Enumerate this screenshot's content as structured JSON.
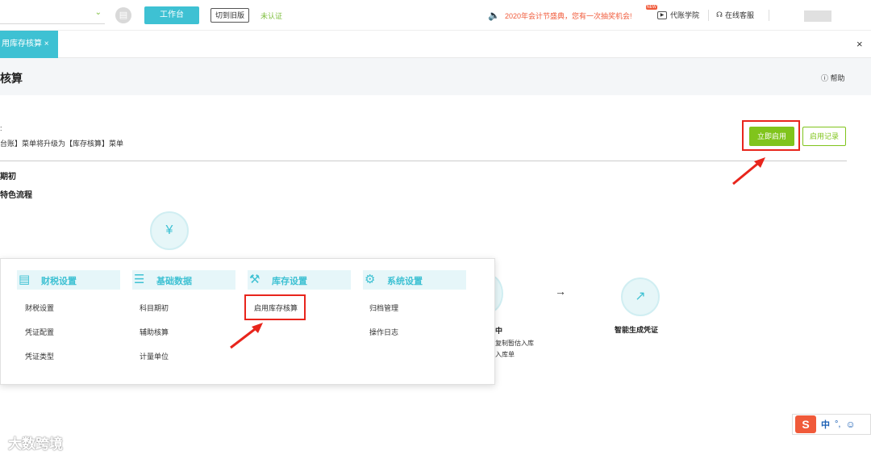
{
  "topbar": {
    "workbench_label": "工作台",
    "old_version_label": "切到旧版",
    "auth_status": "未认证",
    "promo_text": "2020年会计节盛典，您有一次抽奖机会!",
    "academy_badge": "NEW",
    "academy_label": "代账学院",
    "service_label": "在线客服"
  },
  "tabs": {
    "active_label": "用库存核算 ×",
    "close_all": "×"
  },
  "page": {
    "title": "核算",
    "help_label": "帮助"
  },
  "intro": {
    "bullet": ":",
    "text": "台账】菜单将升级为【库存核算】菜单"
  },
  "actions": {
    "enable_label": "立即启用",
    "records_label": "启用记录"
  },
  "sections": {
    "opening": "期初",
    "feature_flow": "特色流程"
  },
  "flow": {
    "arrow": "→",
    "partial_step": "中",
    "partial_desc1": "复制暂估入库",
    "partial_desc2": "入库单",
    "voucher_label": "智能生成凭证"
  },
  "popup": {
    "columns": [
      {
        "icon": "finance-tax-icon",
        "title": "财税设置",
        "items": [
          "财税设置",
          "凭证配置",
          "凭证类型"
        ]
      },
      {
        "icon": "basic-data-icon",
        "title": "基础数据",
        "items": [
          "科目期初",
          "辅助核算",
          "计量单位"
        ]
      },
      {
        "icon": "inventory-settings-icon",
        "title": "库存设置",
        "items": [
          "启用库存核算"
        ]
      },
      {
        "icon": "system-settings-icon",
        "title": "系统设置",
        "items": [
          "归档管理",
          "操作日志"
        ]
      }
    ]
  },
  "watermark": "大数跨境",
  "ime": {
    "logo": "S",
    "lang": "中",
    "punct": "°,",
    "emoji": "☺"
  },
  "colors": {
    "teal": "#3ec1d3",
    "green": "#80c41c",
    "red": "#e8251c",
    "promo": "#f05a3a"
  }
}
